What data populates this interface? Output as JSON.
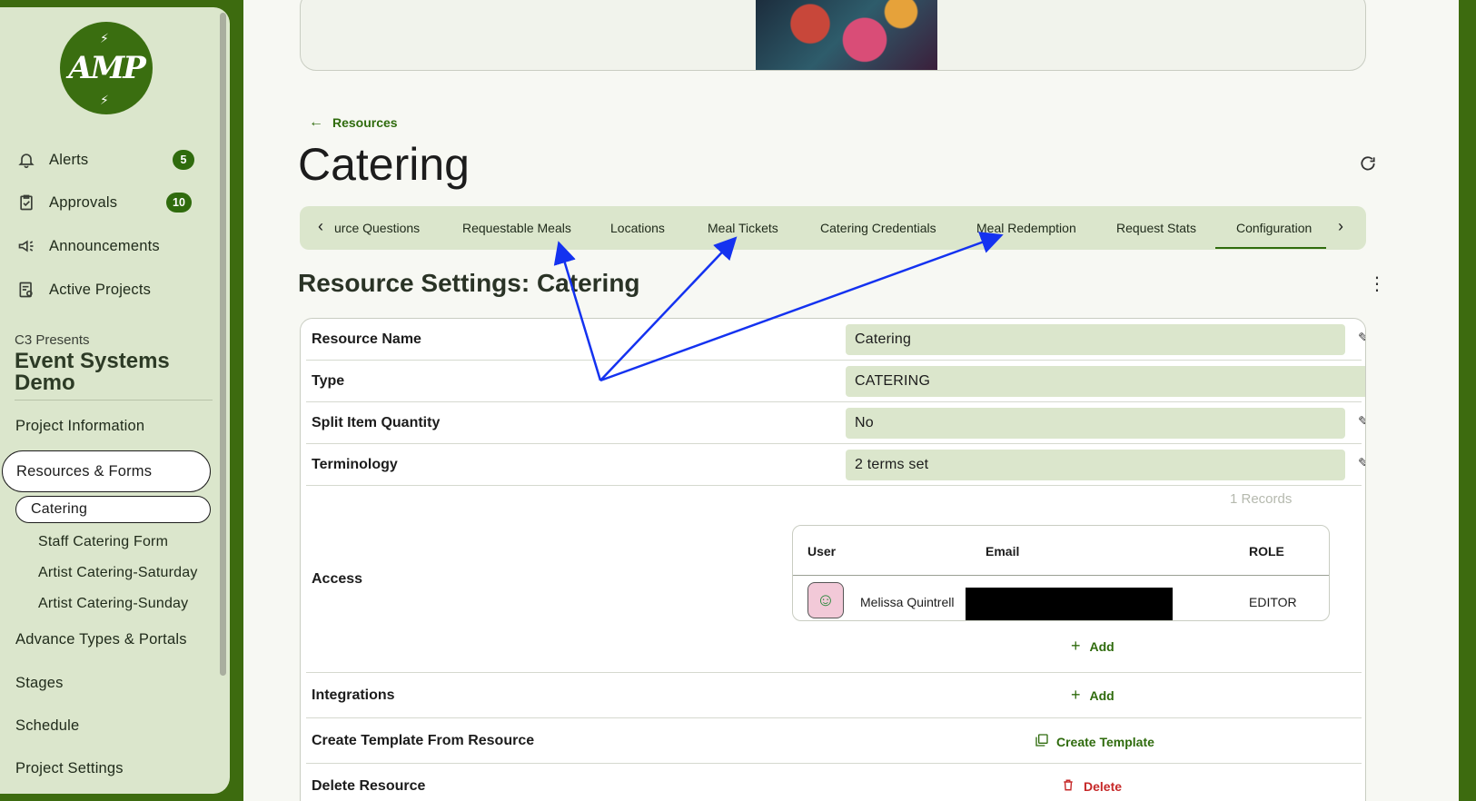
{
  "sidebar": {
    "logo_text": "AMP",
    "nav": [
      {
        "label": "Alerts",
        "badge": "5",
        "icon": "bell-icon"
      },
      {
        "label": "Approvals",
        "badge": "10",
        "icon": "clipboard-check-icon"
      },
      {
        "label": "Announcements",
        "icon": "megaphone-icon"
      },
      {
        "label": "Active Projects",
        "icon": "projects-icon"
      }
    ],
    "org_subtitle": "C3 Presents",
    "org_title": "Event Systems Demo",
    "sections": {
      "project_information": "Project Information",
      "resources_forms": "Resources & Forms",
      "advance_types": "Advance Types & Portals",
      "stages": "Stages",
      "schedule": "Schedule",
      "project_settings": "Project Settings"
    },
    "sub_items": [
      "Catering",
      "Staff Catering Form",
      "Artist Catering-Saturday",
      "Artist Catering-Sunday"
    ]
  },
  "breadcrumb": {
    "back_label": "Resources"
  },
  "page": {
    "title": "Catering"
  },
  "tabs": {
    "items": [
      "urce Questions",
      "Requestable Meals",
      "Locations",
      "Meal Tickets",
      "Catering Credentials",
      "Meal Redemption",
      "Request Stats",
      "Configuration"
    ],
    "active": "Configuration"
  },
  "settings": {
    "title": "Resource Settings: Catering",
    "rows": {
      "resource_name": {
        "label": "Resource Name",
        "value": "Catering"
      },
      "type": {
        "label": "Type",
        "value": "CATERING"
      },
      "split_item_quantity": {
        "label": "Split Item Quantity",
        "value": "No"
      },
      "terminology": {
        "label": "Terminology",
        "value": "2 terms set"
      },
      "access": {
        "label": "Access"
      },
      "integrations": {
        "label": "Integrations"
      },
      "create_template": {
        "label": "Create Template From Resource"
      },
      "delete_resource": {
        "label": "Delete Resource"
      }
    },
    "access_table": {
      "records": "1 Records",
      "columns": [
        "User",
        "Email",
        "ROLE"
      ],
      "rows": [
        {
          "user": "Melissa Quintrell",
          "role": "EDITOR"
        }
      ]
    },
    "add_label": "Add",
    "create_template_label": "Create Template",
    "delete_label": "Delete"
  },
  "colors": {
    "brand_green": "#2f6b0d",
    "frame_green": "#3d6b0f",
    "sidebar_bg": "#dbe6cc",
    "danger": "#c62828",
    "annotation_blue": "#1432f0"
  }
}
